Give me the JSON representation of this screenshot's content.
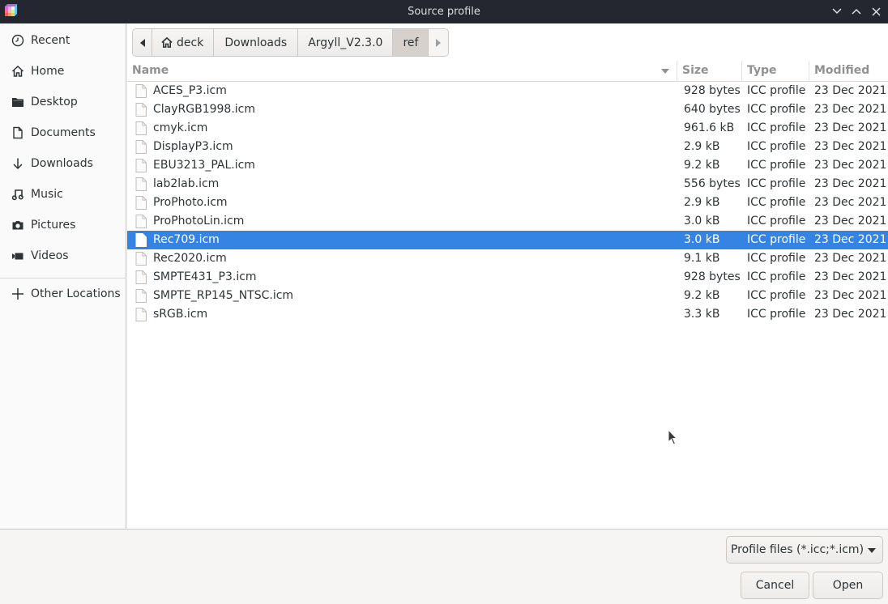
{
  "window": {
    "title": "Source profile",
    "controls": [
      "minimize",
      "maximize",
      "close"
    ]
  },
  "sidebar": {
    "items": [
      {
        "label": "Recent",
        "icon": "clock-icon"
      },
      {
        "label": "Home",
        "icon": "home-icon"
      },
      {
        "label": "Desktop",
        "icon": "folder-icon"
      },
      {
        "label": "Documents",
        "icon": "document-icon"
      },
      {
        "label": "Downloads",
        "icon": "download-arrow-icon"
      },
      {
        "label": "Music",
        "icon": "music-icon"
      },
      {
        "label": "Pictures",
        "icon": "camera-icon"
      },
      {
        "label": "Videos",
        "icon": "video-camera-icon"
      }
    ],
    "other_locations": {
      "label": "Other Locations",
      "icon": "plus-icon"
    }
  },
  "pathbar": {
    "segments": [
      {
        "label": "deck",
        "icon": "home-icon"
      },
      {
        "label": "Downloads"
      },
      {
        "label": "Argyll_V2.3.0"
      },
      {
        "label": "ref",
        "active": true
      }
    ]
  },
  "columns": {
    "name": "Name",
    "size": "Size",
    "type": "Type",
    "modified": "Modified"
  },
  "files": [
    {
      "name": "ACES_P3.icm",
      "size": "928 bytes",
      "type": "ICC profile",
      "modified": "23 Dec 2021"
    },
    {
      "name": "ClayRGB1998.icm",
      "size": "640 bytes",
      "type": "ICC profile",
      "modified": "23 Dec 2021"
    },
    {
      "name": "cmyk.icm",
      "size": "961.6 kB",
      "type": "ICC profile",
      "modified": "23 Dec 2021"
    },
    {
      "name": "DisplayP3.icm",
      "size": "2.9 kB",
      "type": "ICC profile",
      "modified": "23 Dec 2021"
    },
    {
      "name": "EBU3213_PAL.icm",
      "size": "9.2 kB",
      "type": "ICC profile",
      "modified": "23 Dec 2021"
    },
    {
      "name": "lab2lab.icm",
      "size": "556 bytes",
      "type": "ICC profile",
      "modified": "23 Dec 2021"
    },
    {
      "name": "ProPhoto.icm",
      "size": "2.9 kB",
      "type": "ICC profile",
      "modified": "23 Dec 2021"
    },
    {
      "name": "ProPhotoLin.icm",
      "size": "3.0 kB",
      "type": "ICC profile",
      "modified": "23 Dec 2021"
    },
    {
      "name": "Rec709.icm",
      "size": "3.0 kB",
      "type": "ICC profile",
      "modified": "23 Dec 2021",
      "selected": true
    },
    {
      "name": "Rec2020.icm",
      "size": "9.1 kB",
      "type": "ICC profile",
      "modified": "23 Dec 2021"
    },
    {
      "name": "SMPTE431_P3.icm",
      "size": "928 bytes",
      "type": "ICC profile",
      "modified": "23 Dec 2021"
    },
    {
      "name": "SMPTE_RP145_NTSC.icm",
      "size": "9.2 kB",
      "type": "ICC profile",
      "modified": "23 Dec 2021"
    },
    {
      "name": "sRGB.icm",
      "size": "3.3 kB",
      "type": "ICC profile",
      "modified": "23 Dec 2021"
    }
  ],
  "footer": {
    "filter": "Profile files (*.icc;*.icm)",
    "cancel": "Cancel",
    "open": "Open"
  },
  "colors": {
    "titlebar": "#242730",
    "selection": "#3584e4"
  }
}
